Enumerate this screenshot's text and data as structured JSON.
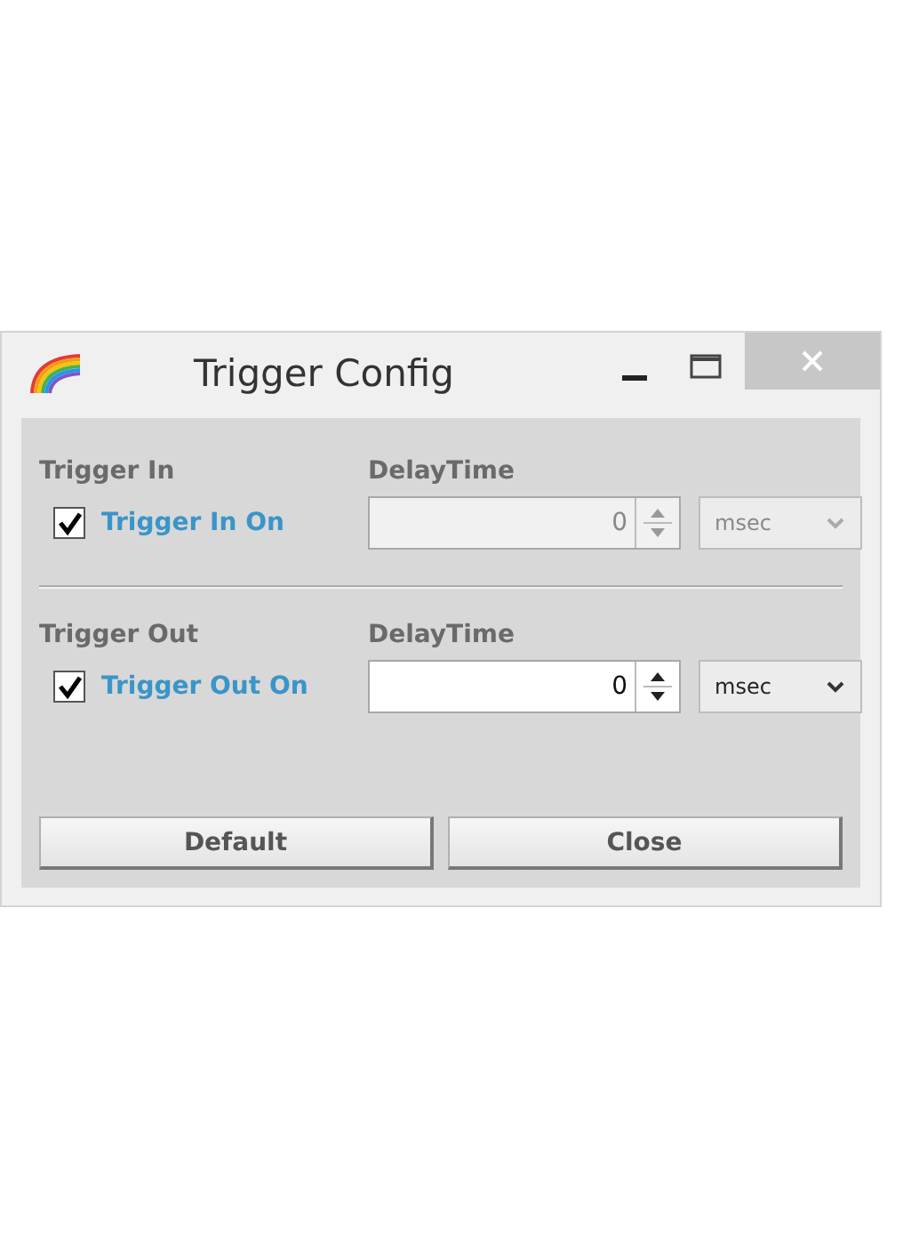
{
  "window": {
    "title": "Trigger Config"
  },
  "sections": [
    {
      "heading": "Trigger In",
      "delay_label": "DelayTime",
      "checkbox": {
        "label": "Trigger In On",
        "checked": true
      },
      "delay": {
        "value": "0",
        "disabled": true
      },
      "unit": {
        "value": "msec",
        "disabled": true
      }
    },
    {
      "heading": "Trigger Out",
      "delay_label": "DelayTime",
      "checkbox": {
        "label": "Trigger Out On",
        "checked": true
      },
      "delay": {
        "value": "0",
        "disabled": false
      },
      "unit": {
        "value": "msec",
        "disabled": false
      }
    }
  ],
  "buttons": [
    "Default",
    "Close"
  ]
}
